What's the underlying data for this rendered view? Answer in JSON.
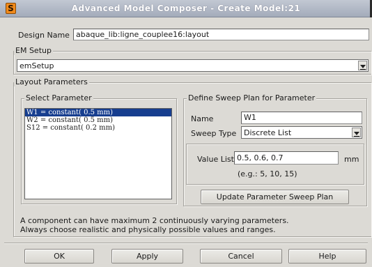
{
  "window": {
    "title": "Advanced Model Composer - Create Model:21",
    "icon": "app-icon"
  },
  "design_name": {
    "label": "Design Name",
    "value": "abaque_lib:ligne_couplee16:layout"
  },
  "em_setup": {
    "legend": "EM Setup",
    "selected": "emSetup"
  },
  "layout_params": {
    "legend": "Layout Parameters",
    "select_parameter": {
      "legend": "Select Parameter",
      "items": [
        "W1 = constant( 0.5 mm)",
        "W2 = constant( 0.5 mm)",
        "S12 = constant( 0.2 mm)"
      ],
      "selected_index": 0
    },
    "sweep_plan": {
      "legend": "Define Sweep Plan for Parameter",
      "name_label": "Name",
      "name_value": "W1",
      "sweep_type_label": "Sweep Type",
      "sweep_type_value": "Discrete List",
      "value_list_label": "Value List",
      "value_list_value": "0.5, 0.6, 0.7",
      "unit": "mm",
      "example": "(e.g.: 5, 10, 15)",
      "update_button": "Update Parameter Sweep Plan"
    },
    "note_line1": "A component can have maximum 2 continuously varying parameters.",
    "note_line2": "Always choose realistic and physically possible values and ranges."
  },
  "buttons": {
    "ok": "OK",
    "apply": "Apply",
    "cancel": "Cancel",
    "help": "Help"
  },
  "colors": {
    "selection": "#173e8f",
    "titlebar": "#a3abba",
    "window_bg": "#dcdad5"
  }
}
